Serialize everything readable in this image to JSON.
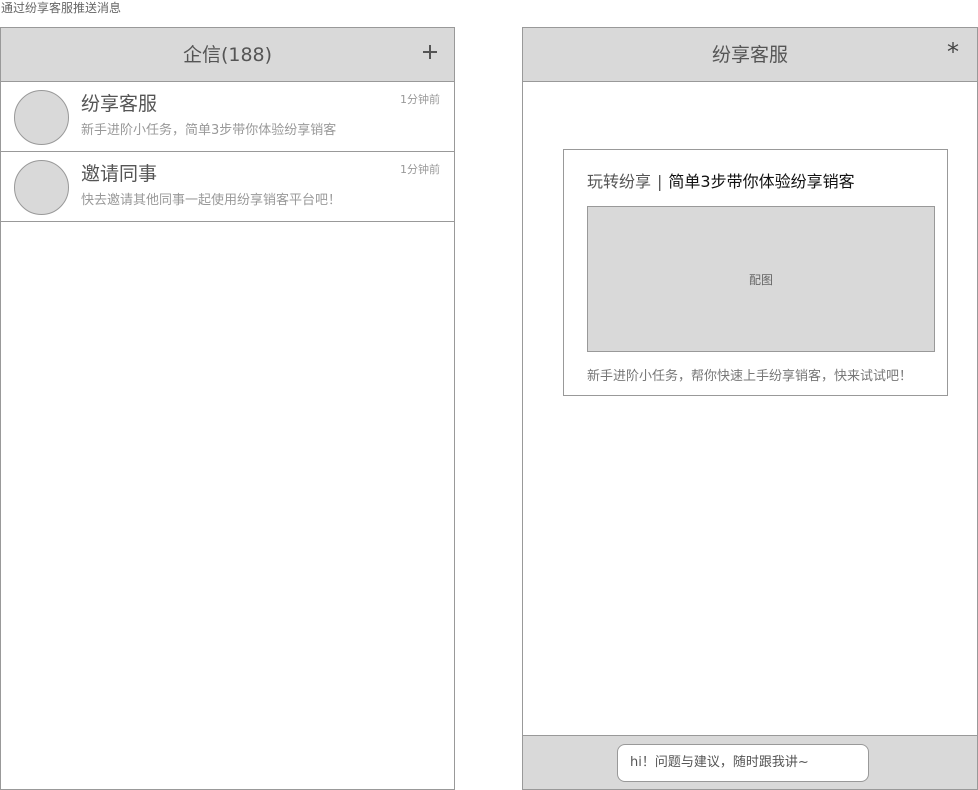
{
  "caption": "通过纷享客服推送消息",
  "left_screen": {
    "title": "企信(188)",
    "chats": [
      {
        "name": "纷享客服",
        "preview": "新手进阶小任务，简单3步带你体验纷享销客",
        "time": "1分钟前"
      },
      {
        "name": "邀请同事",
        "preview": "快去邀请其他同事一起使用纷享销客平台吧！",
        "time": "1分钟前"
      }
    ]
  },
  "right_screen": {
    "title": "纷享客服",
    "close_symbol": "*",
    "card": {
      "title_prefix": "玩转纷享",
      "title_sep": "|",
      "title_main": "简单3步带你体验纷享销客",
      "image_label": "配图",
      "description": "新手进阶小任务，帮你快速上手纷享销客，快来试试吧！"
    },
    "input_text": "hi！问题与建议，随时跟我讲~"
  },
  "colors": {
    "header_bg": "#d9d9d9",
    "border": "#999999"
  }
}
